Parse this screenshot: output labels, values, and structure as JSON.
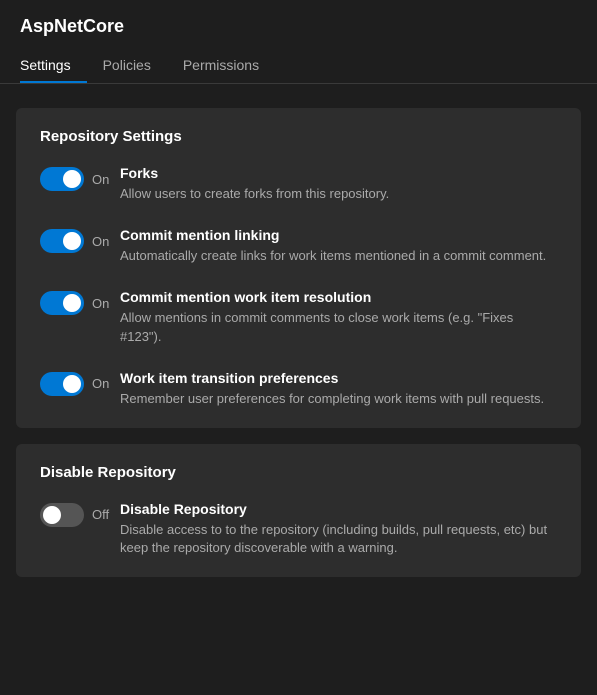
{
  "app": {
    "title": "AspNetCore"
  },
  "tabs": [
    {
      "id": "settings",
      "label": "Settings",
      "active": true
    },
    {
      "id": "policies",
      "label": "Policies",
      "active": false
    },
    {
      "id": "permissions",
      "label": "Permissions",
      "active": false
    }
  ],
  "sections": [
    {
      "id": "repository-settings",
      "title": "Repository Settings",
      "settings": [
        {
          "id": "forks",
          "state": "on",
          "state_label": "On",
          "name": "Forks",
          "description": "Allow users to create forks from this repository."
        },
        {
          "id": "commit-mention-linking",
          "state": "on",
          "state_label": "On",
          "name": "Commit mention linking",
          "description": "Automatically create links for work items mentioned in a commit comment."
        },
        {
          "id": "commit-mention-work-item",
          "state": "on",
          "state_label": "On",
          "name": "Commit mention work item resolution",
          "description": "Allow mentions in commit comments to close work items (e.g. \"Fixes #123\")."
        },
        {
          "id": "work-item-transition",
          "state": "on",
          "state_label": "On",
          "name": "Work item transition preferences",
          "description": "Remember user preferences for completing work items with pull requests."
        }
      ]
    },
    {
      "id": "disable-repository",
      "title": "Disable Repository",
      "settings": [
        {
          "id": "disable-repo",
          "state": "off",
          "state_label": "Off",
          "name": "Disable Repository",
          "description": "Disable access to to the repository (including builds, pull requests, etc) but keep the repository discoverable with a warning."
        }
      ]
    }
  ]
}
